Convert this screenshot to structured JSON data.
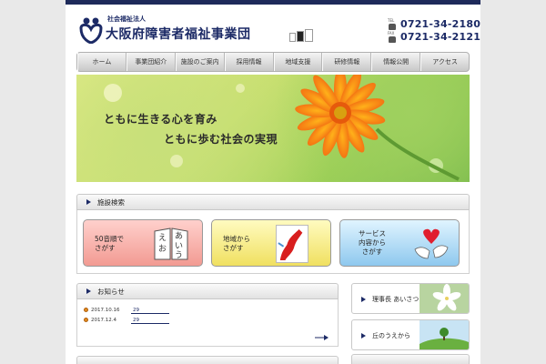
{
  "header": {
    "org_sub": "社会福祉法人",
    "org_name": "大阪府障害者福祉事業団",
    "tel_label": "TEL",
    "tel": "0721-34-2180",
    "fax_label": "FAX",
    "fax": "0721-34-2121"
  },
  "nav": {
    "items": [
      {
        "label": "ホーム"
      },
      {
        "label": "事業団紹介"
      },
      {
        "label": "施設のご案内"
      },
      {
        "label": "採用情報"
      },
      {
        "label": "地域支援"
      },
      {
        "label": "研修情報"
      },
      {
        "label": "情報公開"
      },
      {
        "label": "アクセス"
      }
    ]
  },
  "hero": {
    "line1": "ともに生きる心を育み",
    "line2": "ともに歩む社会の実現"
  },
  "search": {
    "title": "施設検索",
    "box1": {
      "line1": "50音順で",
      "line2": "さがす",
      "icon": "book-icon"
    },
    "box2": {
      "line1": "地域から",
      "line2": "さがす",
      "icon": "map-icon"
    },
    "box3": {
      "line1": "サービス",
      "line2": "内容から",
      "line3": "さがす",
      "icon": "heart-hands-icon"
    }
  },
  "news": {
    "title": "お知らせ",
    "items": [
      {
        "date": "2017.10.16",
        "text": "29"
      },
      {
        "date": "2017.12.4",
        "text": "29"
      }
    ]
  },
  "side": {
    "item1": "理事長 あいさつ",
    "item2": "丘のうえから"
  },
  "colors": {
    "navy": "#1c2a66",
    "accent_orange": "#e08a1e"
  }
}
